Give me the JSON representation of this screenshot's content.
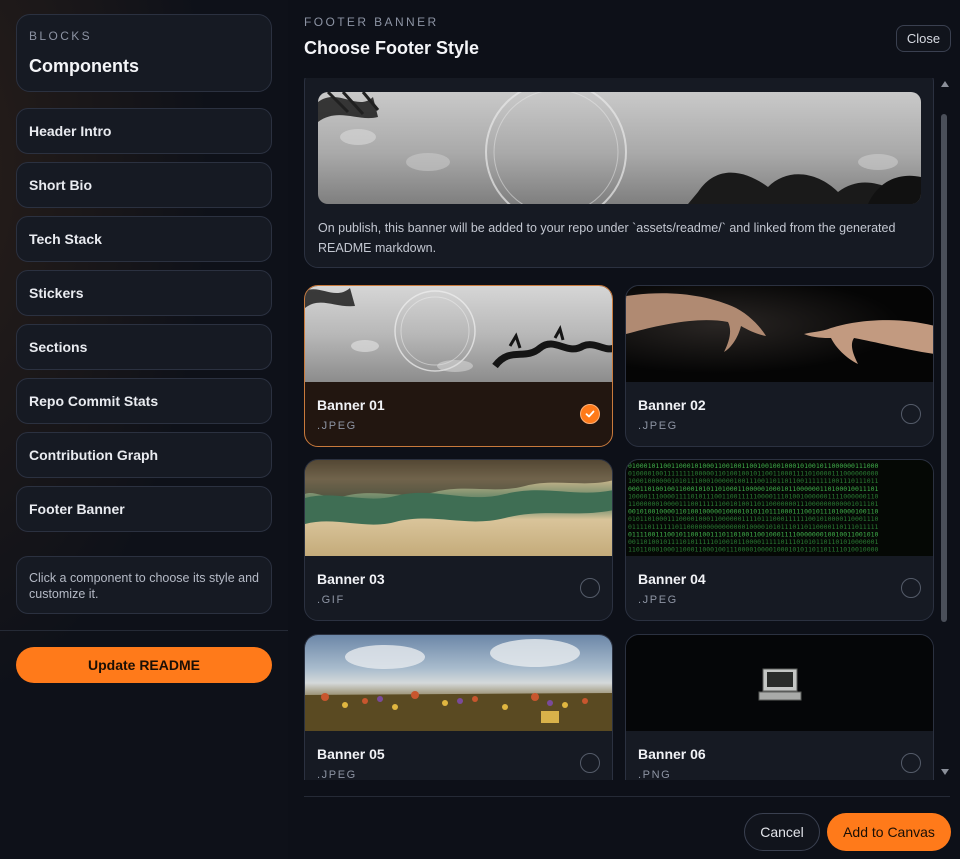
{
  "sidebar": {
    "eyebrow": "BLOCKS",
    "title": "Components",
    "items": [
      {
        "label": "Header Intro"
      },
      {
        "label": "Short Bio"
      },
      {
        "label": "Tech Stack"
      },
      {
        "label": "Stickers"
      },
      {
        "label": "Sections"
      },
      {
        "label": "Repo Commit Stats"
      },
      {
        "label": "Contribution Graph"
      },
      {
        "label": "Footer Banner"
      }
    ],
    "help_text": "Click a component to choose its style and customize it.",
    "update_button": "Update README"
  },
  "main": {
    "eyebrow": "FOOTER BANNER",
    "title": "Choose Footer Style",
    "close_label": "Close",
    "preview_note": "On publish, this banner will be added to your repo under `assets/readme/` and linked from the generated README markdown.",
    "banners": [
      {
        "name": "Banner 01",
        "ext": ".JPEG",
        "selected": true
      },
      {
        "name": "Banner 02",
        "ext": ".JPEG",
        "selected": false
      },
      {
        "name": "Banner 03",
        "ext": ".GIF",
        "selected": false
      },
      {
        "name": "Banner 04",
        "ext": ".JPEG",
        "selected": false
      },
      {
        "name": "Banner 05",
        "ext": ".JPEG",
        "selected": false
      },
      {
        "name": "Banner 06",
        "ext": ".PNG",
        "selected": false
      }
    ],
    "cancel_label": "Cancel",
    "add_label": "Add to Canvas"
  },
  "colors": {
    "accent": "#ff7a1a",
    "background": "#0d1018",
    "card": "#161a23",
    "selected_card": "#221610",
    "border": "#2b3140"
  }
}
